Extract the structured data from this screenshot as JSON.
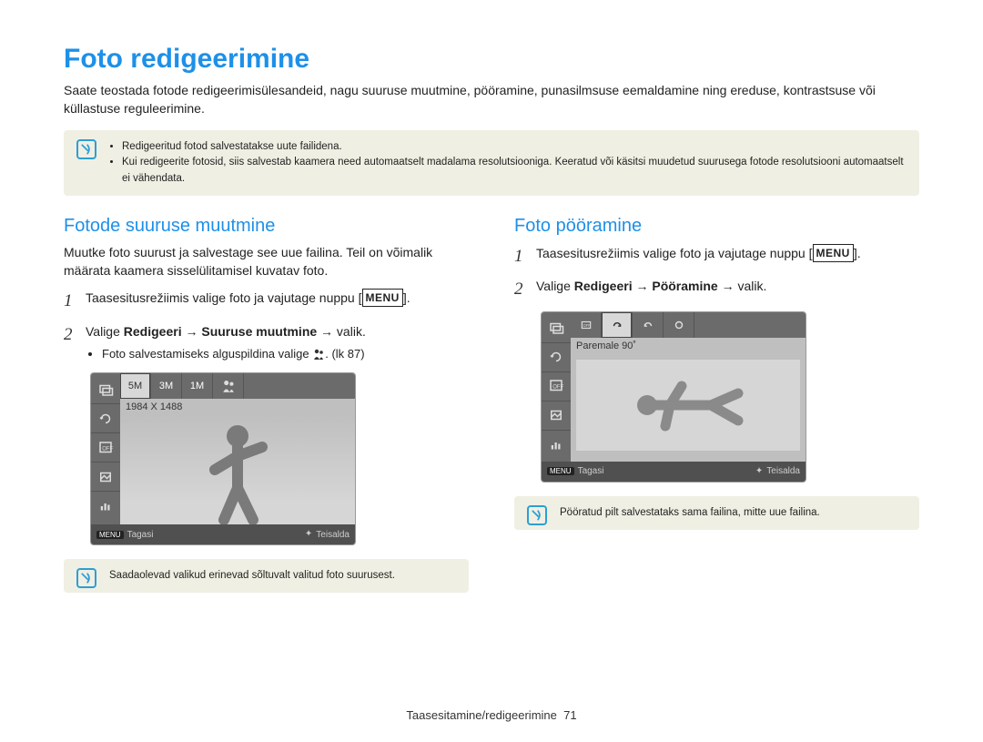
{
  "page": {
    "title": "Foto redigeerimine",
    "intro": "Saate teostada fotode redigeerimisülesandeid, nagu suuruse muutmine, pööramine, punasilmsuse eemaldamine ning ereduse, kontrastsuse või küllastuse reguleerimine."
  },
  "top_note": {
    "items": [
      "Redigeeritud fotod salvestatakse uute failidena.",
      "Kui redigeerite fotosid, siis salvestab kaamera need automaatselt madalama resolutsiooniga. Keeratud või käsitsi muudetud suurusega fotode resolutsiooni automaatselt ei vähendata."
    ]
  },
  "left": {
    "heading": "Fotode suuruse muutmine",
    "desc": "Muutke foto suurust ja salvestage see uue failina. Teil on võimalik määrata kaamera sisselülitamisel kuvatav foto.",
    "step1_num": "1",
    "step1_text": "Taasesitusrežiimis valige foto ja vajutage nuppu ",
    "step1_end": ".",
    "menu_label": "MENU",
    "step2_num": "2",
    "step2_pre": "Valige ",
    "step2_bold": "Redigeeri → Suuruse muutmine",
    "step2_post": " → valik.",
    "sub_bullet": "Foto salvestamiseks alguspildina valige ",
    "sub_bullet_ref": ". (lk 87)",
    "screen": {
      "tabs": [
        "5M",
        "3M",
        "1M"
      ],
      "dimension": "1984 X 1488",
      "bottom_menu": "MENU",
      "bottom_back": "Tagasi",
      "bottom_move": "Teisalda"
    },
    "bottom_note": "Saadaolevad valikud erinevad sõltuvalt valitud foto suurusest."
  },
  "right": {
    "heading": "Foto pööramine",
    "step1_num": "1",
    "step1_text": "Taasesitusrežiimis valige foto ja vajutage nuppu ",
    "step1_end": ".",
    "menu_label": "MENU",
    "step2_num": "2",
    "step2_pre": "Valige ",
    "step2_bold": "Redigeeri → Pööramine",
    "step2_post": " → valik.",
    "screen": {
      "rotate_label": "Paremale 90˚",
      "bottom_menu": "MENU",
      "bottom_back": "Tagasi",
      "bottom_move": "Teisalda"
    },
    "bottom_note": "Pööratud pilt salvestataks sama failina, mitte uue failina."
  },
  "footer": {
    "section": "Taasesitamine/redigeerimine",
    "page_num": "71"
  }
}
